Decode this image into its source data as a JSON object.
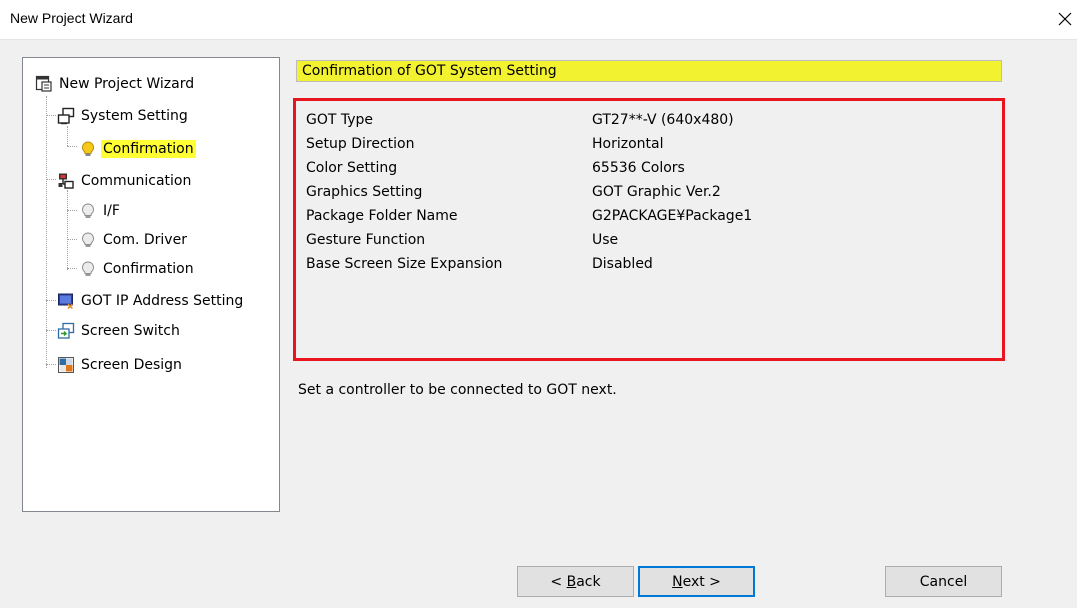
{
  "window": {
    "title": "New Project Wizard",
    "close_glyph": "×"
  },
  "tree": {
    "root": {
      "label": "New Project Wizard",
      "icon": "wizard-icon"
    },
    "items": [
      {
        "label": "System Setting",
        "icon": "system-setting-icon"
      },
      {
        "label": "Confirmation",
        "icon": "lightbulb-icon",
        "selected": true
      },
      {
        "label": "Communication",
        "icon": "communication-icon"
      },
      {
        "label": "I/F",
        "icon": "lightbulb-icon"
      },
      {
        "label": "Com. Driver",
        "icon": "lightbulb-icon"
      },
      {
        "label": "Confirmation",
        "icon": "lightbulb-icon"
      },
      {
        "label": "GOT IP Address Setting",
        "icon": "ip-address-icon"
      },
      {
        "label": "Screen Switch",
        "icon": "screen-switch-icon"
      },
      {
        "label": "Screen Design",
        "icon": "screen-design-icon"
      }
    ]
  },
  "main": {
    "heading": "Confirmation of GOT System Setting",
    "settings": [
      {
        "key": "GOT Type",
        "value": "GT27**-V (640x480)"
      },
      {
        "key": "Setup Direction",
        "value": "Horizontal"
      },
      {
        "key": "Color Setting",
        "value": "65536 Colors"
      },
      {
        "key": "Graphics Setting",
        "value": "GOT Graphic Ver.2"
      },
      {
        "key": "Package Folder Name",
        "value": "G2PACKAGE¥Package1"
      },
      {
        "key": "Gesture Function",
        "value": "Use"
      },
      {
        "key": "Base Screen Size Expansion",
        "value": "Disabled"
      }
    ],
    "message": "Set a controller to be connected to GOT next."
  },
  "buttons": {
    "back": {
      "prefix": "< ",
      "mnemonic": "B",
      "rest": "ack"
    },
    "next": {
      "mnemonic": "N",
      "rest": "ext >"
    },
    "cancel": "Cancel"
  },
  "colors": {
    "highlight": "#ffff33",
    "heading_bg": "#f2f231",
    "frame_red": "#e8141e",
    "focus_blue": "#0078d7"
  }
}
